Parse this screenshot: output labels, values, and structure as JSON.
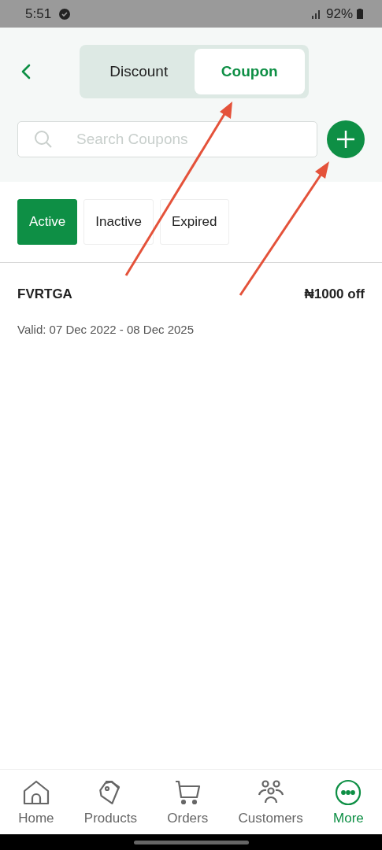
{
  "status_bar": {
    "time": "5:51",
    "battery": "92%"
  },
  "tabs": [
    {
      "label": "Discount",
      "selected": false
    },
    {
      "label": "Coupon",
      "selected": true
    }
  ],
  "search": {
    "placeholder": "Search Coupons"
  },
  "filters": [
    {
      "label": "Active",
      "selected": true
    },
    {
      "label": "Inactive",
      "selected": false
    },
    {
      "label": "Expired",
      "selected": false
    }
  ],
  "coupons": [
    {
      "code": "FVRTGA",
      "amount": "₦1000 off",
      "validity": "Valid: 07 Dec 2022 - 08 Dec 2025"
    }
  ],
  "bottom_nav": [
    {
      "label": "Home",
      "kind": "home",
      "selected": false
    },
    {
      "label": "Products",
      "kind": "tag",
      "selected": false
    },
    {
      "label": "Orders",
      "kind": "cart",
      "selected": false
    },
    {
      "label": "Customers",
      "kind": "people",
      "selected": false
    },
    {
      "label": "More",
      "kind": "more",
      "selected": true
    }
  ]
}
